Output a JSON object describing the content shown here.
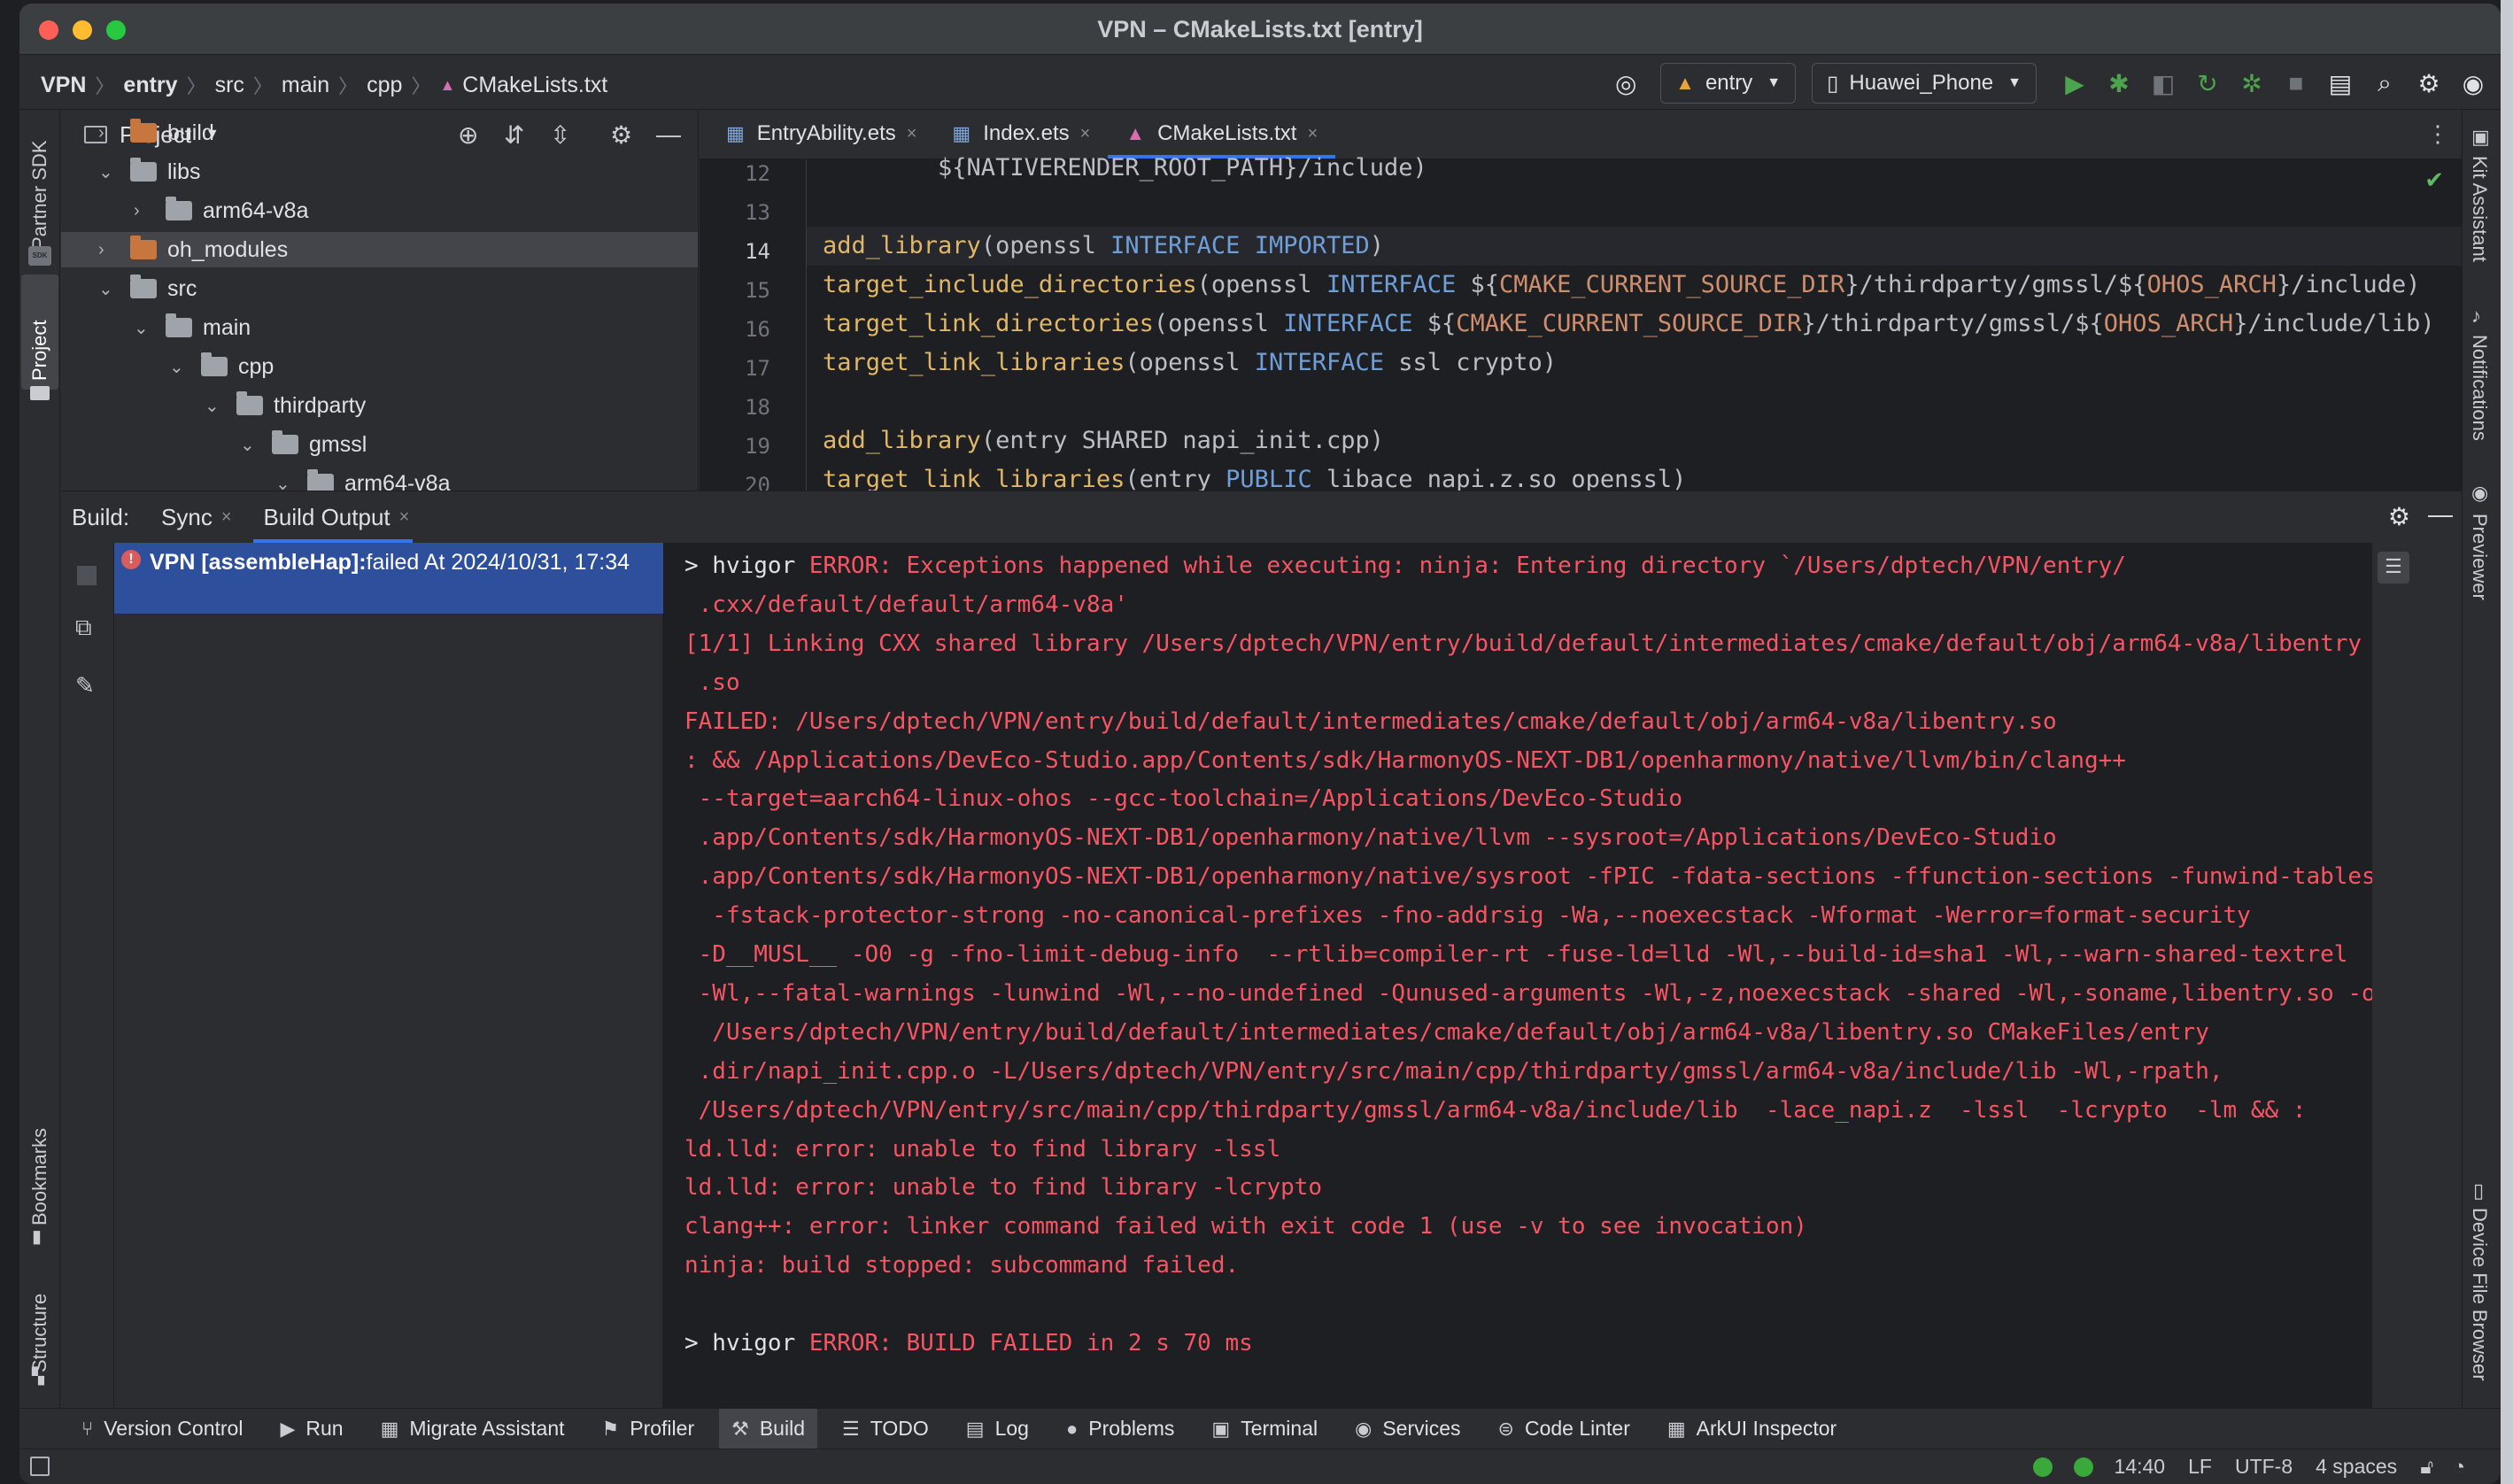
{
  "window": {
    "title": "VPN – CMakeLists.txt [entry]"
  },
  "breadcrumb": [
    "VPN",
    "entry",
    "src",
    "main",
    "cpp",
    "CMakeLists.txt"
  ],
  "toolbar": {
    "module_select": "entry",
    "device_select": "Huawei_Phone"
  },
  "left_stripe": {
    "partner_sdk": "Partner SDK",
    "sdk_badge": "SDK",
    "project": "Project",
    "bookmarks": "Bookmarks",
    "structure": "Structure"
  },
  "right_stripe": {
    "kit_assistant": "Kit Assistant",
    "notifications": "Notifications",
    "previewer": "Previewer",
    "device_file_browser": "Device File Browser"
  },
  "project_panel": {
    "title": "Project",
    "tree": [
      {
        "label": "build",
        "depth": 0,
        "expanded": false,
        "orange": true,
        "selected": false
      },
      {
        "label": "libs",
        "depth": 0,
        "expanded": true,
        "orange": false,
        "selected": false
      },
      {
        "label": "arm64-v8a",
        "depth": 1,
        "expanded": false,
        "orange": false,
        "selected": false
      },
      {
        "label": "oh_modules",
        "depth": 0,
        "expanded": false,
        "orange": true,
        "selected": true
      },
      {
        "label": "src",
        "depth": 0,
        "expanded": true,
        "orange": false,
        "selected": false
      },
      {
        "label": "main",
        "depth": 1,
        "expanded": true,
        "orange": false,
        "selected": false
      },
      {
        "label": "cpp",
        "depth": 2,
        "expanded": true,
        "orange": false,
        "selected": false
      },
      {
        "label": "thirdparty",
        "depth": 3,
        "expanded": true,
        "orange": false,
        "selected": false
      },
      {
        "label": "gmssl",
        "depth": 4,
        "expanded": true,
        "orange": false,
        "selected": false
      },
      {
        "label": "arm64-v8a",
        "depth": 5,
        "expanded": true,
        "orange": false,
        "selected": false
      }
    ]
  },
  "editor": {
    "tabs": [
      {
        "label": "EntryAbility.ets",
        "active": false
      },
      {
        "label": "Index.ets",
        "active": false
      },
      {
        "label": "CMakeLists.txt",
        "active": true
      }
    ],
    "line_numbers": [
      "12",
      "13",
      "14",
      "15",
      "16",
      "17",
      "18",
      "19",
      "20"
    ],
    "current_line": "14",
    "lines": [
      "        ${NATIVERENDER_ROOT_PATH}/include)",
      "",
      "add_library(openssl INTERFACE IMPORTED)",
      "target_include_directories(openssl INTERFACE ${CMAKE_CURRENT_SOURCE_DIR}/thirdparty/gmssl/${OHOS_ARCH}/include)",
      "target_link_directories(openssl INTERFACE ${CMAKE_CURRENT_SOURCE_DIR}/thirdparty/gmssl/${OHOS_ARCH}/include/lib)",
      "target_link_libraries(openssl INTERFACE ssl crypto)",
      "",
      "add_library(entry SHARED napi_init.cpp)",
      "target_link_libraries(entry PUBLIC libace_napi.z.so openssl)"
    ]
  },
  "build_panel": {
    "label": "Build:",
    "tabs": [
      {
        "label": "Sync",
        "active": false
      },
      {
        "label": "Build Output",
        "active": true
      }
    ],
    "tree_row_bold": "VPN [assembleHap]:",
    "tree_row_rest": " failed At 2024/10/31, 17:34",
    "output": [
      {
        "prefix": "> hvigor ",
        "text": "ERROR: Exceptions happened while executing: ninja: Entering directory `/Users/dptech/VPN/entry/"
      },
      {
        "prefix": "",
        "text": " .cxx/default/default/arm64-v8a'"
      },
      {
        "prefix": "",
        "text": "[1/1] Linking CXX shared library /Users/dptech/VPN/entry/build/default/intermediates/cmake/default/obj/arm64-v8a/libentry"
      },
      {
        "prefix": "",
        "text": " .so"
      },
      {
        "prefix": "",
        "text": "FAILED: /Users/dptech/VPN/entry/build/default/intermediates/cmake/default/obj/arm64-v8a/libentry.so"
      },
      {
        "prefix": "",
        "text": ": && /Applications/DevEco-Studio.app/Contents/sdk/HarmonyOS-NEXT-DB1/openharmony/native/llvm/bin/clang++"
      },
      {
        "prefix": "",
        "text": " --target=aarch64-linux-ohos --gcc-toolchain=/Applications/DevEco-Studio"
      },
      {
        "prefix": "",
        "text": " .app/Contents/sdk/HarmonyOS-NEXT-DB1/openharmony/native/llvm --sysroot=/Applications/DevEco-Studio"
      },
      {
        "prefix": "",
        "text": " .app/Contents/sdk/HarmonyOS-NEXT-DB1/openharmony/native/sysroot -fPIC -fdata-sections -ffunction-sections -funwind-tables"
      },
      {
        "prefix": "",
        "text": "  -fstack-protector-strong -no-canonical-prefixes -fno-addrsig -Wa,--noexecstack -Wformat -Werror=format-security"
      },
      {
        "prefix": "",
        "text": " -D__MUSL__ -O0 -g -fno-limit-debug-info  --rtlib=compiler-rt -fuse-ld=lld -Wl,--build-id=sha1 -Wl,--warn-shared-textrel"
      },
      {
        "prefix": "",
        "text": " -Wl,--fatal-warnings -lunwind -Wl,--no-undefined -Qunused-arguments -Wl,-z,noexecstack -shared -Wl,-soname,libentry.so -o"
      },
      {
        "prefix": "",
        "text": "  /Users/dptech/VPN/entry/build/default/intermediates/cmake/default/obj/arm64-v8a/libentry.so CMakeFiles/entry"
      },
      {
        "prefix": "",
        "text": " .dir/napi_init.cpp.o -L/Users/dptech/VPN/entry/src/main/cpp/thirdparty/gmssl/arm64-v8a/include/lib -Wl,-rpath,"
      },
      {
        "prefix": "",
        "text": " /Users/dptech/VPN/entry/src/main/cpp/thirdparty/gmssl/arm64-v8a/include/lib  -lace_napi.z  -lssl  -lcrypto  -lm && :"
      },
      {
        "prefix": "",
        "text": "ld.lld: error: unable to find library -lssl"
      },
      {
        "prefix": "",
        "text": "ld.lld: error: unable to find library -lcrypto"
      },
      {
        "prefix": "",
        "text": "clang++: error: linker command failed with exit code 1 (use -v to see invocation)"
      },
      {
        "prefix": "",
        "text": "ninja: build stopped: subcommand failed."
      },
      {
        "prefix": "",
        "text": ""
      },
      {
        "prefix": "> hvigor ",
        "text": "ERROR: BUILD FAILED in 2 s 70 ms"
      }
    ]
  },
  "bottom_tools": [
    {
      "label": "Version Control",
      "icon": "branch-icon",
      "active": false
    },
    {
      "label": "Run",
      "icon": "play-icon",
      "active": false
    },
    {
      "label": "Migrate Assistant",
      "icon": "migrate-icon",
      "active": false
    },
    {
      "label": "Profiler",
      "icon": "profiler-icon",
      "active": false
    },
    {
      "label": "Build",
      "icon": "hammer-icon",
      "active": true
    },
    {
      "label": "TODO",
      "icon": "list-icon",
      "active": false
    },
    {
      "label": "Log",
      "icon": "log-icon",
      "active": false
    },
    {
      "label": "Problems",
      "icon": "info-icon",
      "active": false
    },
    {
      "label": "Terminal",
      "icon": "terminal-icon",
      "active": false
    },
    {
      "label": "Services",
      "icon": "services-icon",
      "active": false
    },
    {
      "label": "Code Linter",
      "icon": "linter-icon",
      "active": false
    },
    {
      "label": "ArkUI Inspector",
      "icon": "inspector-icon",
      "active": false
    }
  ],
  "status": {
    "position": "14:40",
    "line_ending": "LF",
    "encoding": "UTF-8",
    "indent": "4 spaces"
  },
  "colors": {
    "accent": "#3574f0",
    "error": "#f75464",
    "selection": "#2e4f9c",
    "ok": "#3aa83a"
  }
}
